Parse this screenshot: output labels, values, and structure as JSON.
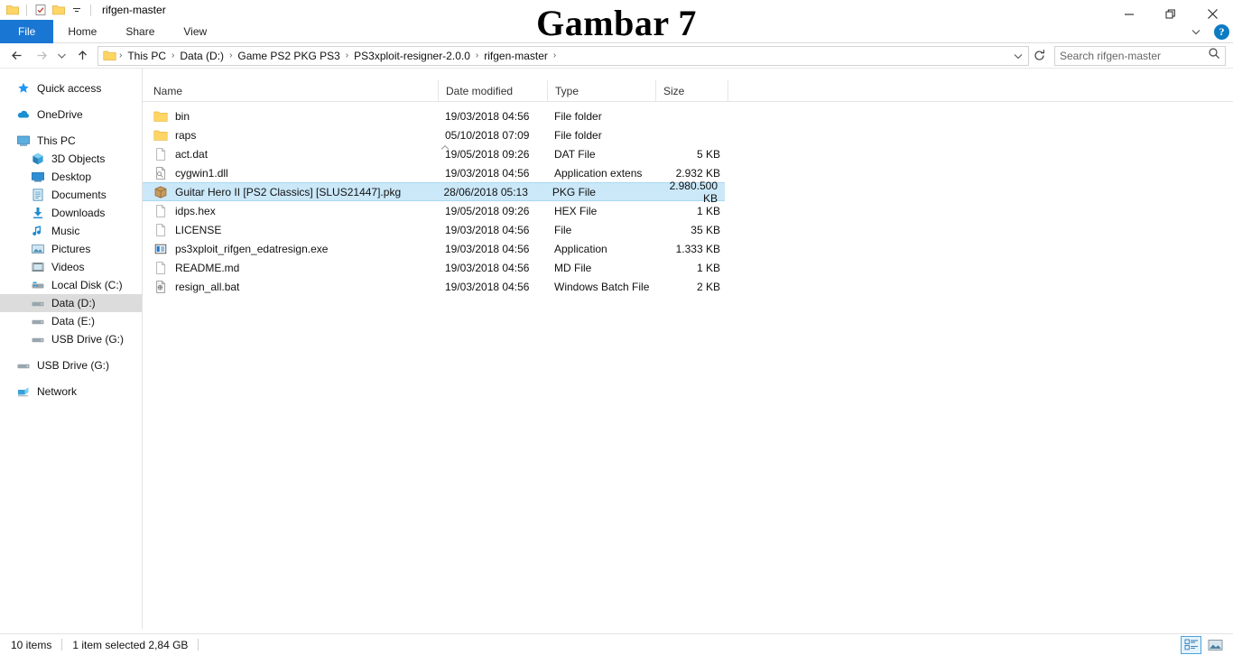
{
  "window": {
    "title": "rifgen-master",
    "quick_access_icons": [
      "folder-icon",
      "properties-icon",
      "new-folder-icon",
      "customize-dropdown-icon"
    ],
    "controls": [
      "minimize-button",
      "restore-button",
      "close-button"
    ]
  },
  "overlay": {
    "caption": "Gambar 7"
  },
  "ribbon": {
    "tabs": [
      {
        "label": "File",
        "active": true
      },
      {
        "label": "Home",
        "active": false
      },
      {
        "label": "Share",
        "active": false
      },
      {
        "label": "View",
        "active": false
      }
    ],
    "expand_icon": "chevron-down-icon",
    "help_icon": "help-icon",
    "help_glyph": "?"
  },
  "address": {
    "back_icon": "back-arrow-icon",
    "forward_icon": "forward-arrow-icon",
    "recent_icon": "chevron-down-icon",
    "up_icon": "up-arrow-icon",
    "breadcrumbs": [
      "This PC",
      "Data (D:)",
      "Game PS2 PKG PS3",
      "PS3xploit-resigner-2.0.0",
      "rifgen-master"
    ],
    "separator": "›",
    "dropdown_icon": "chevron-down-icon",
    "refresh_icon": "refresh-icon"
  },
  "search": {
    "placeholder": "Search rifgen-master",
    "icon": "search-icon"
  },
  "sidebar": {
    "items": [
      {
        "label": "Quick access",
        "icon": "star-icon",
        "level": 0,
        "selected": false,
        "gap_after": true
      },
      {
        "label": "OneDrive",
        "icon": "cloud-icon",
        "level": 0,
        "selected": false,
        "gap_after": true
      },
      {
        "label": "This PC",
        "icon": "monitor-icon",
        "level": 0,
        "selected": false,
        "gap_after": false
      },
      {
        "label": "3D Objects",
        "icon": "cube-icon",
        "level": 1,
        "selected": false,
        "gap_after": false
      },
      {
        "label": "Desktop",
        "icon": "desktop-icon",
        "level": 1,
        "selected": false,
        "gap_after": false
      },
      {
        "label": "Documents",
        "icon": "documents-icon",
        "level": 1,
        "selected": false,
        "gap_after": false
      },
      {
        "label": "Downloads",
        "icon": "download-icon",
        "level": 1,
        "selected": false,
        "gap_after": false
      },
      {
        "label": "Music",
        "icon": "music-note-icon",
        "level": 1,
        "selected": false,
        "gap_after": false
      },
      {
        "label": "Pictures",
        "icon": "picture-icon",
        "level": 1,
        "selected": false,
        "gap_after": false
      },
      {
        "label": "Videos",
        "icon": "video-icon",
        "level": 1,
        "selected": false,
        "gap_after": false
      },
      {
        "label": "Local Disk (C:)",
        "icon": "harddrive-icon",
        "level": 1,
        "selected": false,
        "gap_after": false
      },
      {
        "label": "Data (D:)",
        "icon": "drive-icon",
        "level": 1,
        "selected": true,
        "gap_after": false
      },
      {
        "label": "Data (E:)",
        "icon": "drive-icon",
        "level": 1,
        "selected": false,
        "gap_after": false
      },
      {
        "label": "USB Drive (G:)",
        "icon": "drive-icon",
        "level": 1,
        "selected": false,
        "gap_after": true
      },
      {
        "label": "USB Drive (G:)",
        "icon": "drive-icon",
        "level": 0,
        "selected": false,
        "gap_after": true
      },
      {
        "label": "Network",
        "icon": "network-icon",
        "level": 0,
        "selected": false,
        "gap_after": false
      }
    ]
  },
  "filelist": {
    "columns": [
      {
        "label": "Name",
        "sorted": true,
        "sort_direction": "ascending"
      },
      {
        "label": "Date modified",
        "sorted": false
      },
      {
        "label": "Type",
        "sorted": false
      },
      {
        "label": "Size",
        "sorted": false
      }
    ],
    "sort_caret_icon": "sort-ascending-caret-icon",
    "rows": [
      {
        "name": "bin",
        "date": "19/03/2018 04:56",
        "type": "File folder",
        "size": "",
        "icon": "folder-icon",
        "selected": false
      },
      {
        "name": "raps",
        "date": "05/10/2018 07:09",
        "type": "File folder",
        "size": "",
        "icon": "folder-icon",
        "selected": false
      },
      {
        "name": "act.dat",
        "date": "19/05/2018 09:26",
        "type": "DAT File",
        "size": "5 KB",
        "icon": "generic-file-icon",
        "selected": false
      },
      {
        "name": "cygwin1.dll",
        "date": "19/03/2018 04:56",
        "type": "Application extens",
        "size": "2.932 KB",
        "icon": "dll-file-icon",
        "selected": false
      },
      {
        "name": "Guitar Hero II [PS2 Classics] [SLUS21447].pkg",
        "date": "28/06/2018 05:13",
        "type": "PKG File",
        "size": "2.980.500 KB",
        "icon": "package-file-icon",
        "selected": true
      },
      {
        "name": "idps.hex",
        "date": "19/05/2018 09:26",
        "type": "HEX File",
        "size": "1 KB",
        "icon": "generic-file-icon",
        "selected": false
      },
      {
        "name": "LICENSE",
        "date": "19/03/2018 04:56",
        "type": "File",
        "size": "35 KB",
        "icon": "generic-file-icon",
        "selected": false
      },
      {
        "name": "ps3xploit_rifgen_edatresign.exe",
        "date": "19/03/2018 04:56",
        "type": "Application",
        "size": "1.333 KB",
        "icon": "application-exe-icon",
        "selected": false
      },
      {
        "name": "README.md",
        "date": "19/03/2018 04:56",
        "type": "MD File",
        "size": "1 KB",
        "icon": "generic-file-icon",
        "selected": false
      },
      {
        "name": "resign_all.bat",
        "date": "19/03/2018 04:56",
        "type": "Windows Batch File",
        "size": "2 KB",
        "icon": "batch-file-icon",
        "selected": false
      }
    ]
  },
  "statusbar": {
    "item_count": "10 items",
    "selection_info": "1 item selected  2,84 GB",
    "view_details_icon": "details-view-icon",
    "view_large_icons_icon": "large-icons-view-icon"
  },
  "colors": {
    "accent": "#1976d2",
    "selection": "#cbe8f9",
    "selection_border": "#aad8f2",
    "sidebar_selection": "#dcdcdc",
    "folder_yellow": "#ffd666"
  }
}
